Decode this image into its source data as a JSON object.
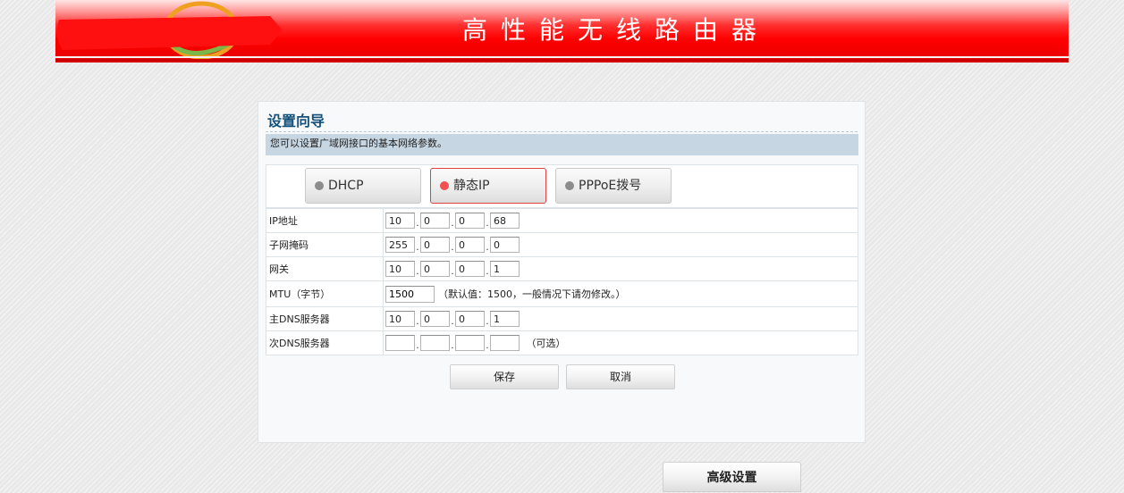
{
  "header": {
    "title": "高性能无线路由器",
    "logo": "brand-logo"
  },
  "colors": {
    "header_red": "#ff0000",
    "panel_title": "#14517a",
    "desc_bar": "#c6d6e2",
    "active_mode_border": "#e04040",
    "active_dot": "#f05050",
    "inactive_dot": "#8c8c8c"
  },
  "wizard": {
    "title": "设置向导",
    "description": "您可以设置广域网接口的基本网络参数。",
    "modes": [
      {
        "label": "DHCP",
        "selected": false
      },
      {
        "label": "静态IP",
        "selected": true
      },
      {
        "label": "PPPoE拨号",
        "selected": false
      }
    ],
    "fields": {
      "ip": {
        "label": "IP地址",
        "octets": [
          "10",
          "0",
          "0",
          "68"
        ]
      },
      "mask": {
        "label": "子网掩码",
        "octets": [
          "255",
          "0",
          "0",
          "0"
        ]
      },
      "gateway": {
        "label": "网关",
        "octets": [
          "10",
          "0",
          "0",
          "1"
        ]
      },
      "mtu": {
        "label": "MTU（字节）",
        "value": "1500",
        "hint": "（默认值：1500，一般情况下请勿修改。）"
      },
      "dns1": {
        "label": "主DNS服务器",
        "octets": [
          "10",
          "0",
          "0",
          "1"
        ]
      },
      "dns2": {
        "label": "次DNS服务器",
        "octets": [
          "",
          "",
          "",
          ""
        ],
        "hint": "（可选）"
      }
    },
    "save_label": "保存",
    "cancel_label": "取消"
  },
  "advanced_label": "高级设置"
}
